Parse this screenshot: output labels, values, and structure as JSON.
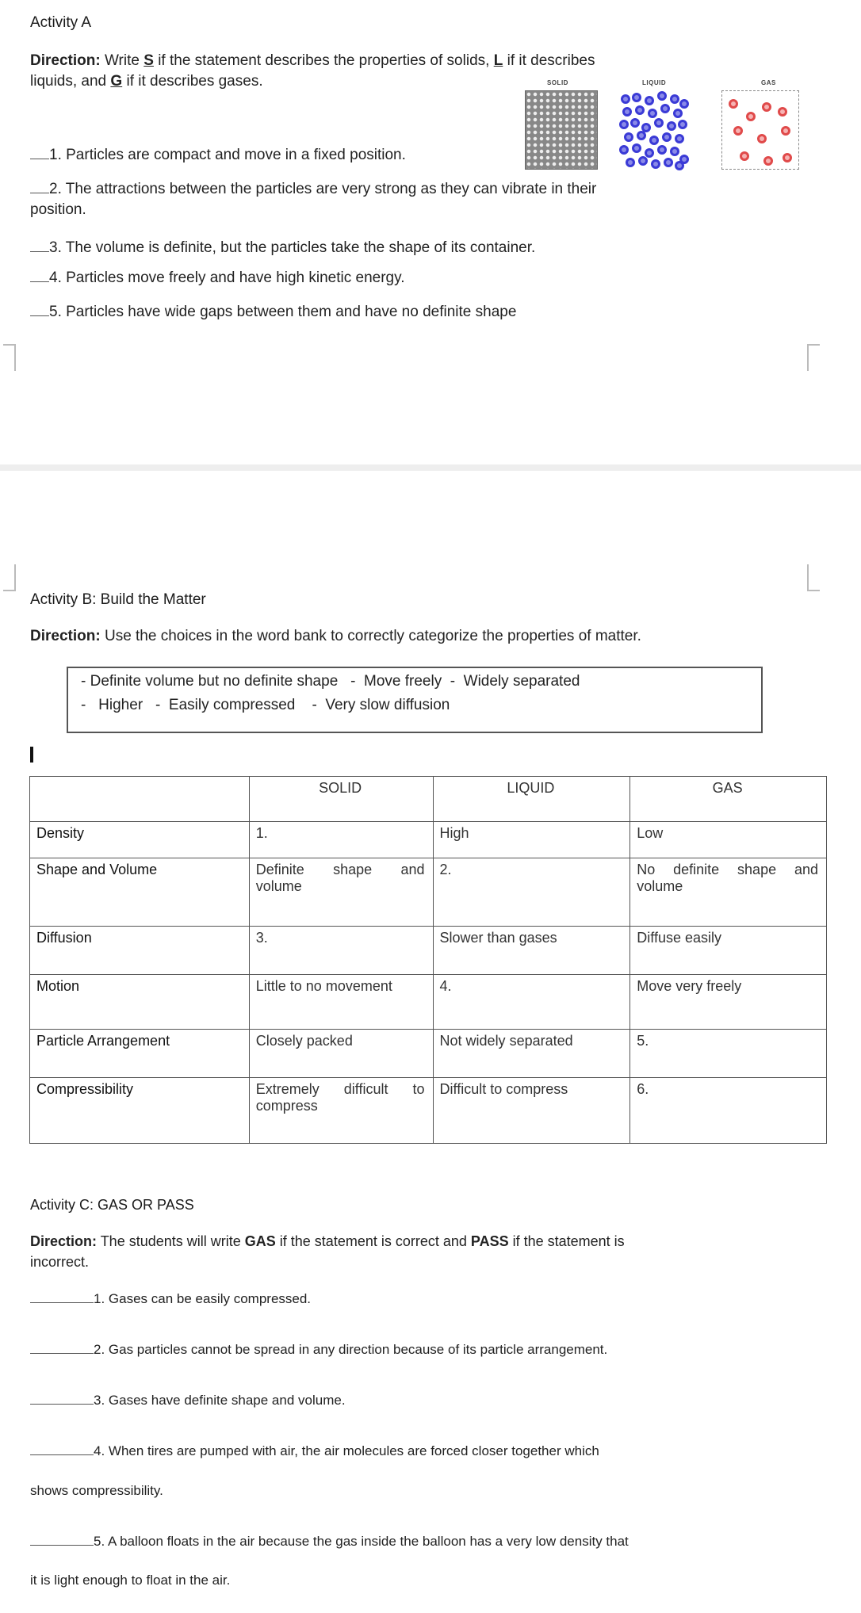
{
  "activity_a": {
    "title": "Activity A",
    "direction_label": "Direction:",
    "direction_parts": [
      "Write ",
      "S",
      " if the statement describes the properties of solids, ",
      "L",
      " if it describes"
    ],
    "direction_line2_parts": [
      "liquids, and ",
      "G",
      " if it describes gases."
    ],
    "illustration": {
      "labels": [
        "SOLID",
        "LIQUID",
        "GAS"
      ],
      "colors": {
        "solid": "#888888",
        "liquid": "#3a3ad6",
        "gas": "#e04a4a"
      }
    },
    "items": [
      {
        "text": "1. Particles are compact and move in a fixed position."
      },
      {
        "text": "2. The attractions between the particles are very strong as they can vibrate in their",
        "cont": "position."
      },
      {
        "text": "3. The volume is definite, but the particles take the shape of its container."
      },
      {
        "text": "4. Particles move freely and have high kinetic energy."
      },
      {
        "text": "5. Particles have wide gaps between them and have no definite shape"
      }
    ]
  },
  "activity_b": {
    "title": "Activity B: Build the Matter",
    "direction_label": "Direction:",
    "direction_text": " Use the choices in the word bank to correctly categorize the properties of matter.",
    "word_bank": {
      "line1": [
        "Definite volume but no definite shape",
        "Move freely",
        "Widely separated"
      ],
      "line2": [
        "Higher",
        "Easily compressed",
        "Very slow diffusion"
      ]
    },
    "table": {
      "columns": [
        "",
        "SOLID",
        "LIQUID",
        "GAS"
      ],
      "rows": [
        {
          "label": "Density",
          "solid": "1.",
          "liquid": "High",
          "gas": "Low"
        },
        {
          "label": "Shape and Volume",
          "solid": "Definite shape and volume",
          "liquid": "2.",
          "gas": "No definite shape and volume"
        },
        {
          "label": "Diffusion",
          "solid": "3.",
          "liquid": "Slower than gases",
          "gas": "Diffuse easily"
        },
        {
          "label": "Motion",
          "solid": "Little to no movement",
          "liquid": "4.",
          "gas": "Move very freely"
        },
        {
          "label": "Particle Arrangement",
          "solid": "Closely packed",
          "liquid": "Not widely separated",
          "gas": "5."
        },
        {
          "label": "Compressibility",
          "solid": "Extremely difficult to compress",
          "liquid": "Difficult to compress",
          "gas": "6."
        }
      ]
    }
  },
  "activity_c": {
    "title": "Activity C: GAS OR PASS",
    "direction_label": "Direction:",
    "direction_parts": [
      " The students will write ",
      "GAS",
      " if the statement is correct and ",
      "PASS",
      " if the statement is"
    ],
    "direction_line2": "incorrect.",
    "items": [
      {
        "text": "1. Gases can be easily compressed."
      },
      {
        "text": "2. Gas particles cannot be spread in any direction because of its particle arrangement."
      },
      {
        "text": "3. Gases have definite shape and volume."
      },
      {
        "text": "4. When tires are pumped with air, the air molecules are forced closer together which",
        "cont": "shows compressibility."
      },
      {
        "text": "5. A balloon floats in the air because the gas inside the balloon has a very low density that",
        "cont": "it is light enough to float in the air."
      }
    ]
  }
}
